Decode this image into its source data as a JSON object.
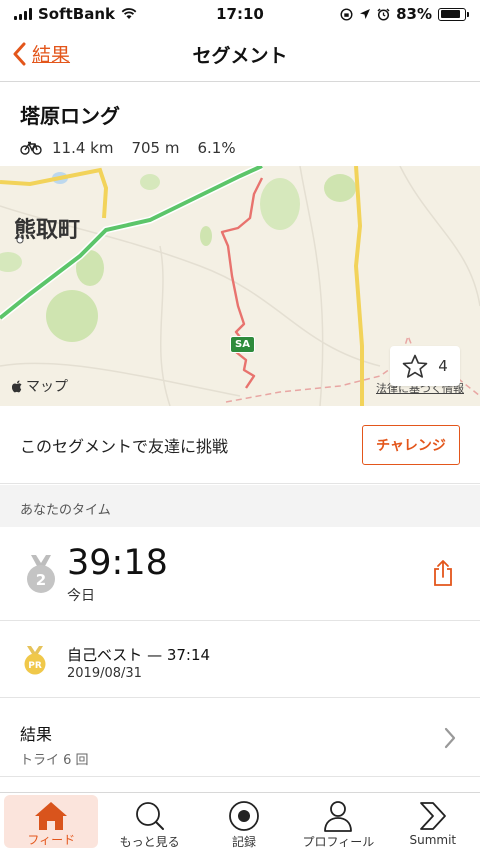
{
  "status_bar": {
    "carrier": "SoftBank",
    "time": "17:10",
    "battery": "83%",
    "battery_level": 0.83
  },
  "nav": {
    "back_label": "結果",
    "title": "セグメント"
  },
  "segment": {
    "name": "塔原ロング",
    "distance": "11.4 km",
    "elevation": "705 m",
    "grade": "6.1%"
  },
  "map": {
    "town_label": "熊取町",
    "road_badge": "SA",
    "attribution": "マップ",
    "legal": "法律に基づく情報",
    "star_count": "4",
    "colors": {
      "route": "#e8736e",
      "highway": "#5cc56a",
      "road": "#f2d35a",
      "park": "#cfe4b0"
    }
  },
  "challenge": {
    "text": "このセグメントで友達に挑戦",
    "button_label": "チャレンジ"
  },
  "your_time": {
    "section_label": "あなたのタイム",
    "rank": "2",
    "time": "39:18",
    "date": "今日"
  },
  "personal_best": {
    "badge": "PR",
    "title": "自己ベスト — 37:14",
    "date": "2019/08/31"
  },
  "results": {
    "title": "結果",
    "subtitle": "トライ 6 回"
  },
  "tabs": [
    {
      "label": "フィード",
      "icon": "home-icon",
      "active": true
    },
    {
      "label": "もっと見る",
      "icon": "search-icon",
      "active": false
    },
    {
      "label": "記録",
      "icon": "record-icon",
      "active": false
    },
    {
      "label": "プロフィール",
      "icon": "profile-icon",
      "active": false
    },
    {
      "label": "Summit",
      "icon": "summit-icon",
      "active": false
    }
  ],
  "accent_color": "#e3561b"
}
